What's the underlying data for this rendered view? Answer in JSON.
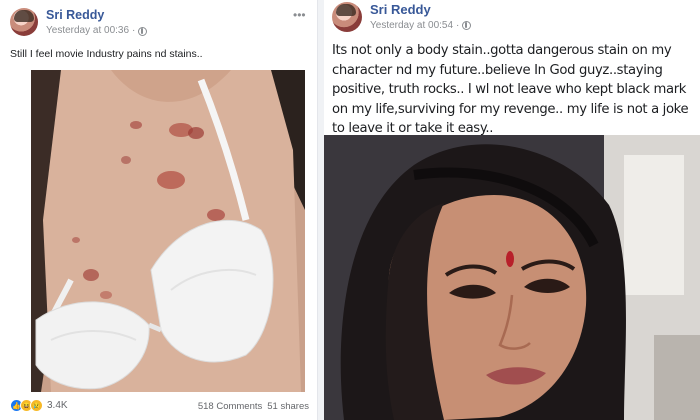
{
  "left_post": {
    "author": "Sri Reddy",
    "timestamp": "Yesterday at 00:36",
    "privacy_icon": "globe-icon",
    "menu_icon": "more-options-icon",
    "caption": "Still I feel movie Industry pains nd stains..",
    "reactions": {
      "icons": [
        "like-icon",
        "haha-icon",
        "sad-icon"
      ],
      "count": "3.4K"
    },
    "comments": "518 Comments",
    "shares": "51 shares"
  },
  "right_post": {
    "author": "Sri Reddy",
    "timestamp": "Yesterday at 00:54",
    "privacy_icon": "globe-icon",
    "caption": "Its not only a body stain..gotta dangerous stain on my character nd my future..believe In God guyz..staying positive, truth rocks.. I wl not leave who kept black mark on my life,surviving for my revenge.. my life is not a joke to leave it or take it easy.."
  },
  "colors": {
    "author_link": "#385898",
    "meta_gray": "#8a8d91",
    "like_blue": "#1877f2",
    "reaction_yellow": "#f7b928"
  }
}
